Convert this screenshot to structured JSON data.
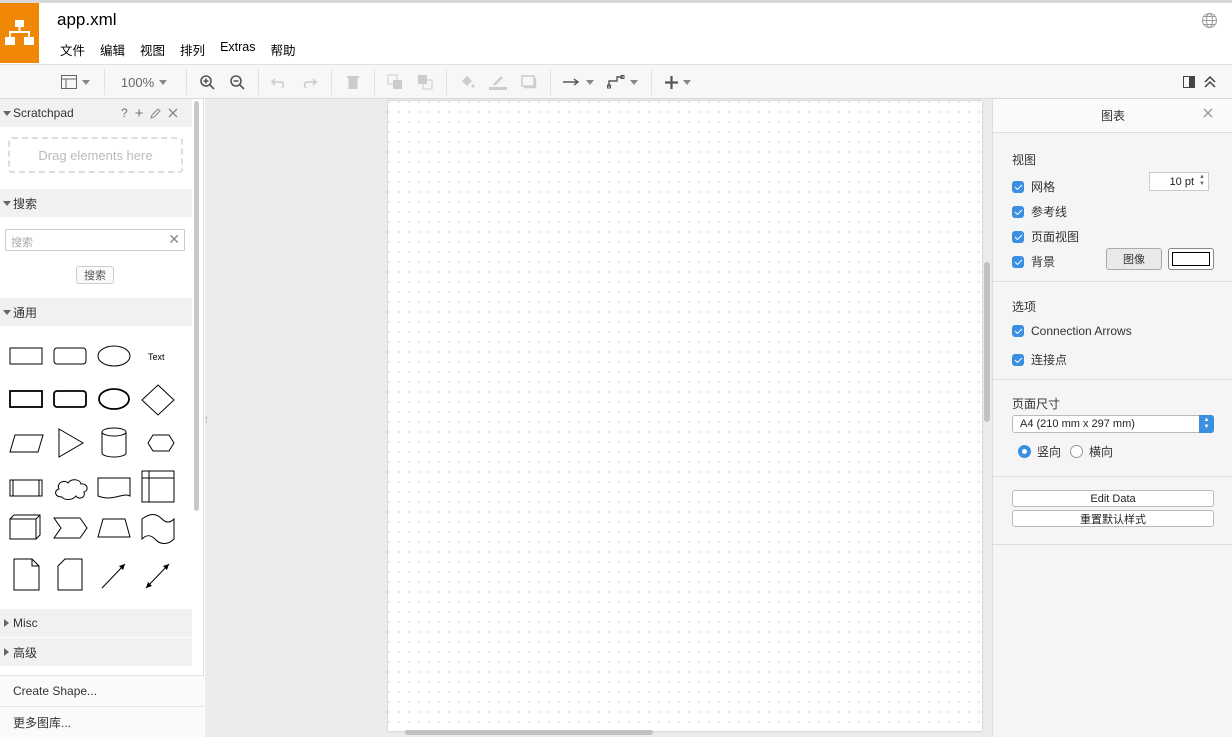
{
  "app": {
    "file_title": "app.xml"
  },
  "menu": [
    "文件",
    "编辑",
    "视图",
    "排列",
    "Extras",
    "帮助"
  ],
  "toolbar": {
    "zoom": "100%"
  },
  "left": {
    "scratchpad": {
      "title": "Scratchpad",
      "help": "?",
      "add": "+",
      "drop_hint": "Drag elements here"
    },
    "search": {
      "title": "搜索",
      "placeholder": "搜索",
      "button": "搜索"
    },
    "general": {
      "title": "通用",
      "text_shape": "Text"
    },
    "misc": "Misc",
    "advanced": "高级",
    "create_shape": "Create Shape...",
    "more_libraries": "更多图库..."
  },
  "right": {
    "title": "图表",
    "view": {
      "title": "视图",
      "grid": "网格",
      "grid_size": "10 pt",
      "guides": "参考线",
      "page_view": "页面视图",
      "background": "背景",
      "image_button": "图像"
    },
    "options": {
      "title": "选项",
      "connection_arrows": "Connection Arrows",
      "connection_points": "连接点"
    },
    "page_size": {
      "title": "页面尺寸",
      "selected": "A4 (210 mm x 297 mm)",
      "portrait": "竖向",
      "landscape": "横向"
    },
    "edit_data": "Edit Data",
    "reset_style": "重置默认样式"
  },
  "colors": {
    "brand": "#f08705",
    "accent": "#3b8fe0"
  }
}
